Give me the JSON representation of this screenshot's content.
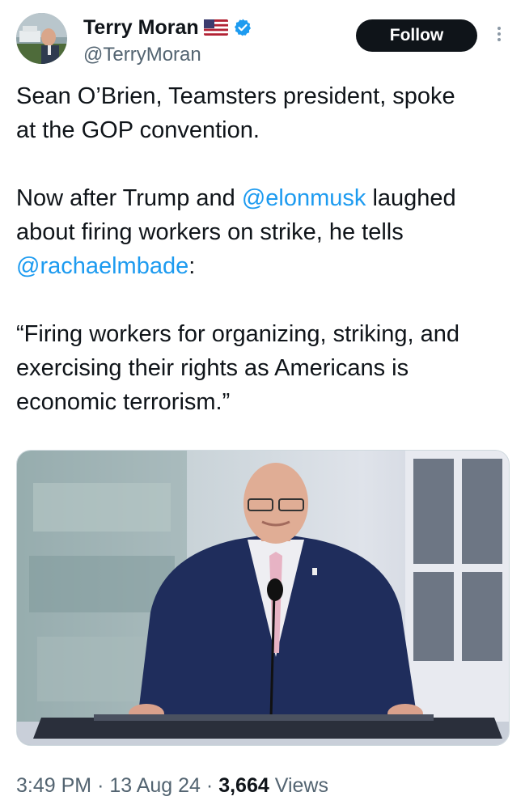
{
  "tweet": {
    "author": {
      "display_name": "Terry Moran",
      "handle": "@TerryMoran",
      "flag_icon": "us-flag-icon",
      "verified_icon": "verified-badge-icon",
      "verified_color": "#1d9bf0"
    },
    "follow_label": "Follow",
    "text": {
      "p1": "Sean O’Brien, Teamsters president, spoke at the GOP convention.",
      "p2_before": "Now after Trump and ",
      "p2_mention1": "@elonmusk",
      "p2_middle": " laughed about  firing workers on strike, he tells ",
      "p2_mention2": "@rachaelmbade",
      "p2_after": ":",
      "p3": "“Firing workers for organizing, striking, and exercising their rights as Americans is economic terrorism.”"
    },
    "media": {
      "type": "photo"
    },
    "meta": {
      "time": "3:49 PM",
      "sep": "·",
      "date": "13 Aug 24",
      "views_count": "3,664",
      "views_label": "Views"
    }
  },
  "colors": {
    "accent": "#1d9bf0",
    "text": "#0f1419",
    "secondary": "#536471",
    "follow_bg": "#0f1419"
  }
}
